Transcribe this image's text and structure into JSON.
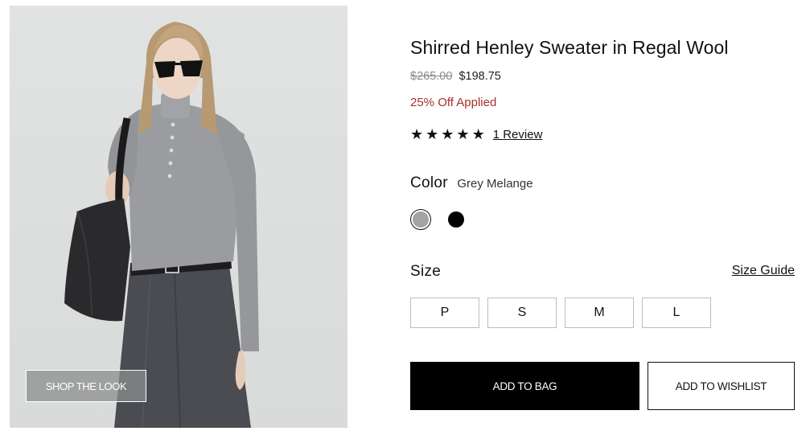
{
  "image": {
    "shop_the_look_label": "SHOP THE LOOK"
  },
  "product": {
    "title": "Shirred Henley Sweater in Regal Wool",
    "price_original": "$265.00",
    "price_sale": "$198.75",
    "discount_text": "25% Off Applied",
    "rating": {
      "stars_filled": 5,
      "stars_total": 5,
      "star_glyph": "★",
      "reviews_link": "1 Review"
    },
    "color": {
      "label": "Color",
      "selected_value": "Grey Melange",
      "swatches": [
        {
          "name": "Grey Melange",
          "hex": "#a3a3a3",
          "selected": true
        },
        {
          "name": "Black",
          "hex": "#000000",
          "selected": false
        }
      ]
    },
    "size": {
      "label": "Size",
      "guide_link": "Size Guide",
      "options": [
        "P",
        "S",
        "M",
        "L"
      ]
    },
    "actions": {
      "add_to_bag": "ADD TO BAG",
      "add_to_wishlist": "ADD TO WISHLIST"
    }
  },
  "colors": {
    "discount_red": "#a5312a",
    "primary_button_bg": "#000000",
    "border_gray": "#bdbdbd"
  }
}
